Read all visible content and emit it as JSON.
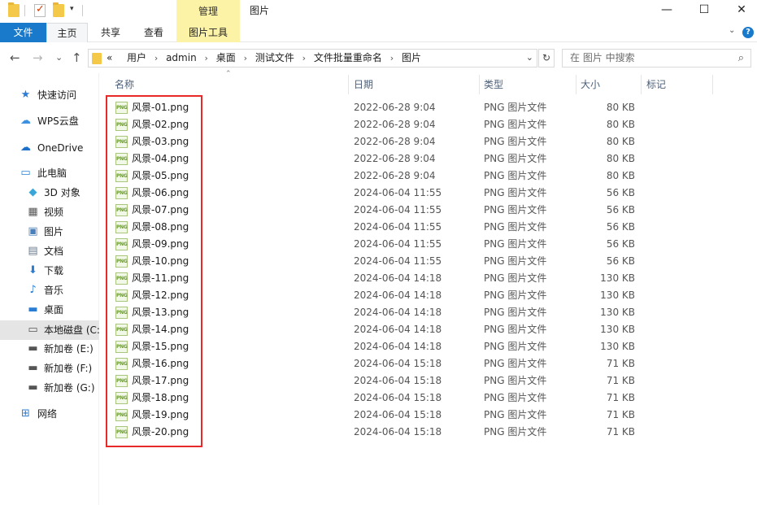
{
  "window": {
    "title": "图片",
    "context_tab": "管理",
    "controls": {
      "minimize": "—",
      "maximize": "☐",
      "close": "✕"
    }
  },
  "ribbon": {
    "tabs": [
      {
        "label": "文件"
      },
      {
        "label": "主页"
      },
      {
        "label": "共享"
      },
      {
        "label": "查看"
      },
      {
        "label": "图片工具"
      }
    ],
    "collapse": "⌄",
    "help": "?"
  },
  "nav": {
    "back": "←",
    "forward": "→",
    "recent": "⌄",
    "up": "↑",
    "overflow": "«",
    "breadcrumbs": [
      "用户",
      "admin",
      "桌面",
      "测试文件",
      "文件批量重命名",
      "图片"
    ],
    "separator": "›",
    "dropdown": "⌄",
    "refresh": "↻",
    "search_placeholder": "在 图片 中搜索",
    "search_icon": "⌕"
  },
  "sidebar": {
    "items": [
      {
        "label": "快速访问",
        "icon": "★",
        "color": "#2b7cd3"
      },
      {
        "label": "WPS云盘",
        "icon": "☁",
        "color": "#3d8fe0"
      },
      {
        "label": "OneDrive",
        "icon": "☁",
        "color": "#1e6fc8"
      },
      {
        "label": "此电脑",
        "icon": "▭",
        "color": "#2a83d6"
      },
      {
        "label": "3D 对象",
        "icon": "◆",
        "color": "#3aa6d8"
      },
      {
        "label": "视频",
        "icon": "▦",
        "color": "#555555"
      },
      {
        "label": "图片",
        "icon": "▣",
        "color": "#4a7fb8"
      },
      {
        "label": "文档",
        "icon": "▤",
        "color": "#6b7b8c"
      },
      {
        "label": "下载",
        "icon": "⬇",
        "color": "#2b7cd3"
      },
      {
        "label": "音乐",
        "icon": "♪",
        "color": "#2b7cd3"
      },
      {
        "label": "桌面",
        "icon": "▬",
        "color": "#2b7cd3"
      },
      {
        "label": "本地磁盘 (C:)",
        "icon": "▭",
        "color": "#555555"
      },
      {
        "label": "新加卷 (E:)",
        "icon": "▬",
        "color": "#555555"
      },
      {
        "label": "新加卷 (F:)",
        "icon": "▬",
        "color": "#555555"
      },
      {
        "label": "新加卷 (G:)",
        "icon": "▬",
        "color": "#555555"
      },
      {
        "label": "网络",
        "icon": "⊞",
        "color": "#2b7cd3"
      }
    ]
  },
  "columns": {
    "name": "名称",
    "date": "日期",
    "type": "类型",
    "size": "大小",
    "tags": "标记",
    "sort_indicator": "⌃"
  },
  "files": [
    {
      "name": "风景-01.png",
      "date": "2022-06-28 9:04",
      "type": "PNG 图片文件",
      "size": "80 KB"
    },
    {
      "name": "风景-02.png",
      "date": "2022-06-28 9:04",
      "type": "PNG 图片文件",
      "size": "80 KB"
    },
    {
      "name": "风景-03.png",
      "date": "2022-06-28 9:04",
      "type": "PNG 图片文件",
      "size": "80 KB"
    },
    {
      "name": "风景-04.png",
      "date": "2022-06-28 9:04",
      "type": "PNG 图片文件",
      "size": "80 KB"
    },
    {
      "name": "风景-05.png",
      "date": "2022-06-28 9:04",
      "type": "PNG 图片文件",
      "size": "80 KB"
    },
    {
      "name": "风景-06.png",
      "date": "2024-06-04 11:55",
      "type": "PNG 图片文件",
      "size": "56 KB"
    },
    {
      "name": "风景-07.png",
      "date": "2024-06-04 11:55",
      "type": "PNG 图片文件",
      "size": "56 KB"
    },
    {
      "name": "风景-08.png",
      "date": "2024-06-04 11:55",
      "type": "PNG 图片文件",
      "size": "56 KB"
    },
    {
      "name": "风景-09.png",
      "date": "2024-06-04 11:55",
      "type": "PNG 图片文件",
      "size": "56 KB"
    },
    {
      "name": "风景-10.png",
      "date": "2024-06-04 11:55",
      "type": "PNG 图片文件",
      "size": "56 KB"
    },
    {
      "name": "风景-11.png",
      "date": "2024-06-04 14:18",
      "type": "PNG 图片文件",
      "size": "130 KB"
    },
    {
      "name": "风景-12.png",
      "date": "2024-06-04 14:18",
      "type": "PNG 图片文件",
      "size": "130 KB"
    },
    {
      "name": "风景-13.png",
      "date": "2024-06-04 14:18",
      "type": "PNG 图片文件",
      "size": "130 KB"
    },
    {
      "name": "风景-14.png",
      "date": "2024-06-04 14:18",
      "type": "PNG 图片文件",
      "size": "130 KB"
    },
    {
      "name": "风景-15.png",
      "date": "2024-06-04 14:18",
      "type": "PNG 图片文件",
      "size": "130 KB"
    },
    {
      "name": "风景-16.png",
      "date": "2024-06-04 15:18",
      "type": "PNG 图片文件",
      "size": "71 KB"
    },
    {
      "name": "风景-17.png",
      "date": "2024-06-04 15:18",
      "type": "PNG 图片文件",
      "size": "71 KB"
    },
    {
      "name": "风景-18.png",
      "date": "2024-06-04 15:18",
      "type": "PNG 图片文件",
      "size": "71 KB"
    },
    {
      "name": "风景-19.png",
      "date": "2024-06-04 15:18",
      "type": "PNG 图片文件",
      "size": "71 KB"
    },
    {
      "name": "风景-20.png",
      "date": "2024-06-04 15:18",
      "type": "PNG 图片文件",
      "size": "71 KB"
    }
  ],
  "file_icon_label": "PNG",
  "colors": {
    "accent": "#1979ca",
    "context_tab": "#fdf3a6",
    "highlight": "#e8292a",
    "selection": "#e5e5e5"
  }
}
